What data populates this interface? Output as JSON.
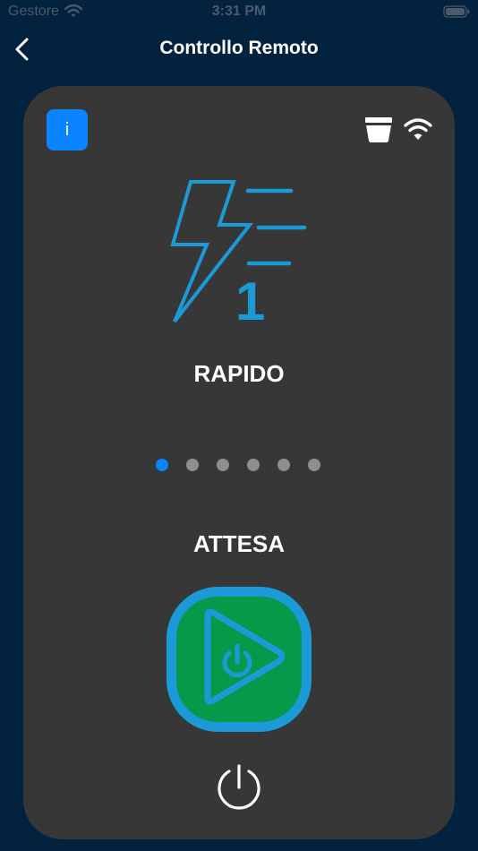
{
  "status_bar": {
    "carrier": "Gestore",
    "time": "3:31 PM"
  },
  "nav": {
    "title": "Controllo Remoto",
    "back_icon": "chevron-left-icon"
  },
  "card": {
    "info_label": "i",
    "mode_label": "RAPIDO",
    "mode_number": "1",
    "status_label": "ATTESA",
    "page_count": 6,
    "active_page": 0
  },
  "colors": {
    "background": "#03223d",
    "card": "#373737",
    "accent": "#0a84ff",
    "icon_blue": "#1a9ad6",
    "play_green": "#06994a"
  }
}
